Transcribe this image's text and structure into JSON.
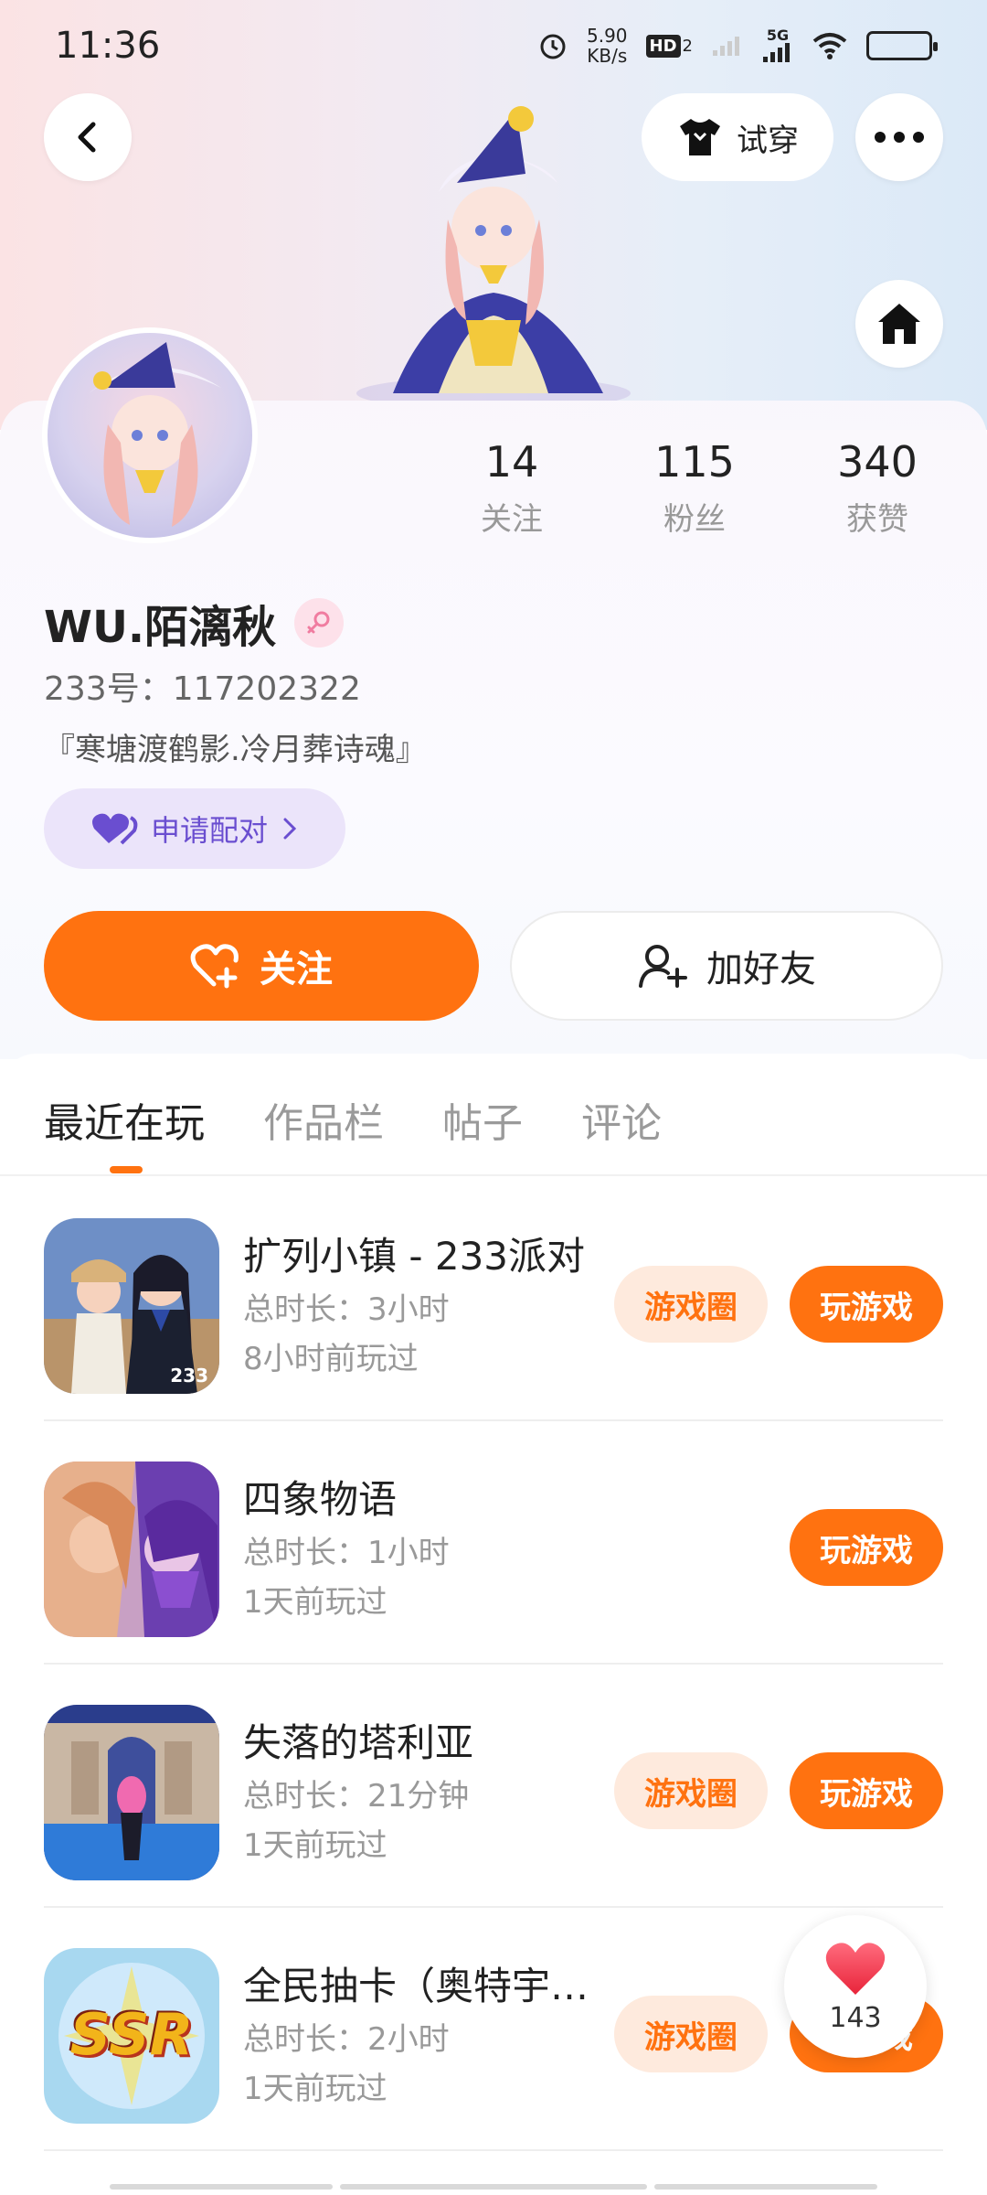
{
  "status_bar": {
    "time": "11:36",
    "net_speed_value": "5.90",
    "net_speed_unit": "KB/s",
    "hd_label": "HD",
    "hd_sub": "2",
    "network": "5G",
    "battery_level_pct": 80
  },
  "header": {
    "tryon_label": "试穿"
  },
  "profile": {
    "nickname": "WU.陌漓秋",
    "user_id": "233号：117202322",
    "bio": "『寒塘渡鹤影.冷月葬诗魂』",
    "pair_label": "申请配对",
    "stats": [
      {
        "value": "14",
        "label": "关注"
      },
      {
        "value": "115",
        "label": "粉丝"
      },
      {
        "value": "340",
        "label": "获赞"
      }
    ],
    "follow_label": "关注",
    "add_friend_label": "加好友"
  },
  "tabs": [
    {
      "label": "最近在玩",
      "active": true
    },
    {
      "label": "作品栏",
      "active": false
    },
    {
      "label": "帖子",
      "active": false
    },
    {
      "label": "评论",
      "active": false
    }
  ],
  "games": [
    {
      "name": "扩列小镇 - 233派对",
      "duration": "总时长：3小时",
      "last_played": "8小时前玩过",
      "circle_label": "游戏圈",
      "play_label": "玩游戏",
      "icon_badge": "233"
    },
    {
      "name": "四象物语",
      "duration": "总时长：1小时",
      "last_played": "1天前玩过",
      "circle_label": "",
      "play_label": "玩游戏",
      "icon_badge": ""
    },
    {
      "name": "失落的塔利亚",
      "duration": "总时长：21分钟",
      "last_played": "1天前玩过",
      "circle_label": "游戏圈",
      "play_label": "玩游戏",
      "icon_badge": ""
    },
    {
      "name": "全民抽卡（奥特宇…",
      "duration": "总时长：2小时",
      "last_played": "1天前玩过",
      "circle_label": "游戏圈",
      "play_label": "玩游戏",
      "icon_badge": "SSR"
    }
  ],
  "like_float": {
    "count": "143"
  },
  "colors": {
    "accent": "#ff7210",
    "accent_light": "#feeadd",
    "pair_bg": "#ebe4fa",
    "pair_text": "#6a4ed0"
  }
}
